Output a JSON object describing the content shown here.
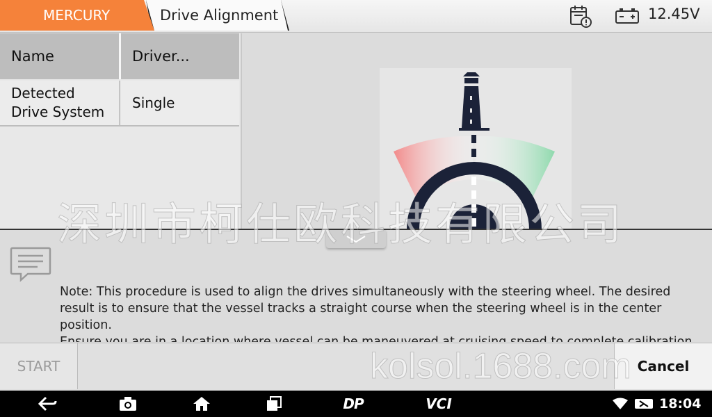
{
  "header": {
    "brand_tab": "MERCURY",
    "page_tab": "Drive Alignment",
    "voltage": "12.45V"
  },
  "table": {
    "header": {
      "col1": "Name",
      "col2": "Driver..."
    },
    "rows": [
      {
        "name": "Detected\nDrive System",
        "value": "Single"
      }
    ]
  },
  "note": {
    "lines": [
      "Note: This procedure is used to align the drives simultaneously with the steering wheel.  The desired result is to ensure that the vessel tracks a straight course when the steering wheel is in the center position.",
      "Ensure you are in a location where vessel can be maneuvered at cruising speed to complete calibration."
    ]
  },
  "actions": {
    "start": "START",
    "cancel": "Cancel"
  },
  "system_bar": {
    "time": "18:04",
    "dp_label": "DP",
    "vci_label": "VCI"
  },
  "watermarks": {
    "cn": "深圳市柯仕欧科技有限公司",
    "site": "kolsol.1688.com"
  },
  "colors": {
    "accent": "#f5823a",
    "navy": "#1b2238",
    "red_zone": "#f28a8a",
    "green_zone": "#8fd9ad"
  }
}
